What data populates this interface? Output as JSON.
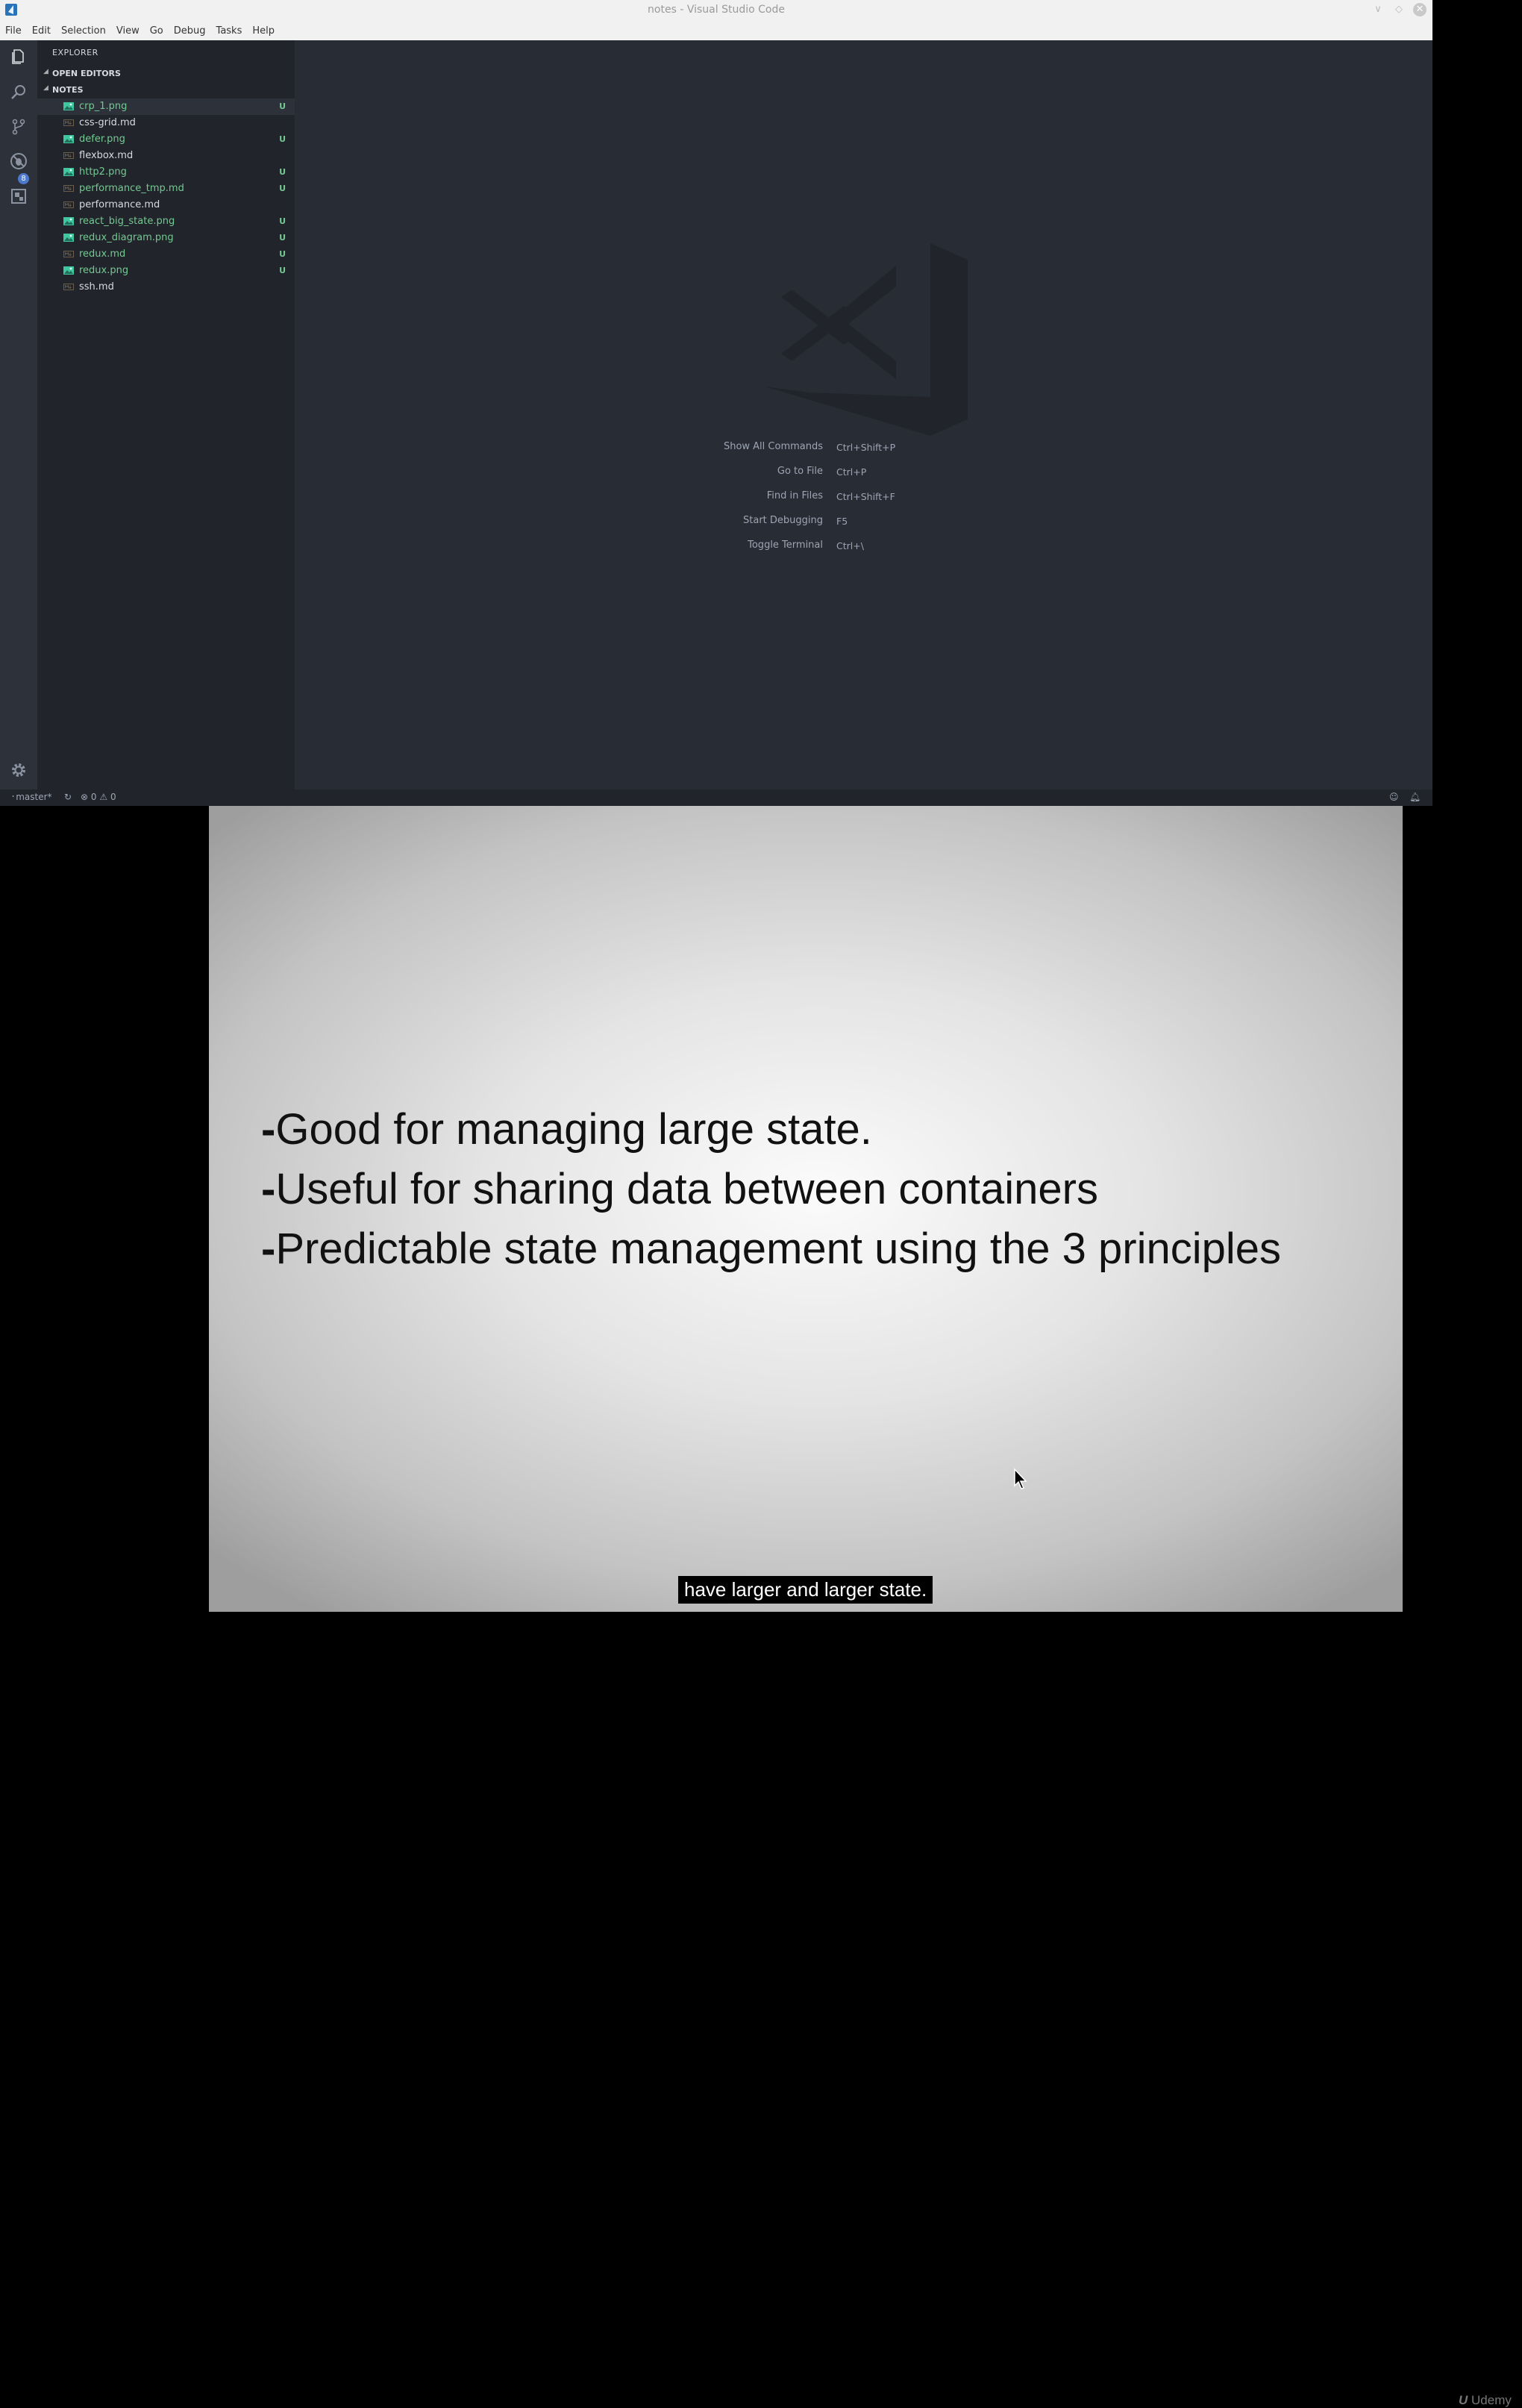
{
  "window": {
    "title": "notes - Visual Studio Code",
    "controls": [
      "minimize",
      "maximize",
      "close"
    ]
  },
  "menu": [
    "File",
    "Edit",
    "Selection",
    "View",
    "Go",
    "Debug",
    "Tasks",
    "Help"
  ],
  "activity_bar": {
    "icons": [
      "files-icon",
      "search-icon",
      "source-control-icon",
      "debug-icon",
      "extensions-icon",
      "gear-icon"
    ],
    "scm_badge": "8"
  },
  "explorer": {
    "title": "EXPLORER",
    "open_editors": "OPEN EDITORS",
    "folder": "NOTES",
    "files": [
      {
        "name": "crp_1.png",
        "type": "image",
        "status": "U",
        "color": "#73c991"
      },
      {
        "name": "css-grid.md",
        "type": "markdown",
        "status": "",
        "color": "#d7dae0"
      },
      {
        "name": "defer.png",
        "type": "image",
        "status": "U",
        "color": "#73c991"
      },
      {
        "name": "flexbox.md",
        "type": "markdown",
        "status": "",
        "color": "#d7dae0"
      },
      {
        "name": "http2.png",
        "type": "image",
        "status": "U",
        "color": "#73c991"
      },
      {
        "name": "performance_tmp.md",
        "type": "markdown",
        "status": "U",
        "color": "#73c991"
      },
      {
        "name": "performance.md",
        "type": "markdown",
        "status": "",
        "color": "#d7dae0"
      },
      {
        "name": "react_big_state.png",
        "type": "image",
        "status": "U",
        "color": "#73c991"
      },
      {
        "name": "redux_diagram.png",
        "type": "image",
        "status": "U",
        "color": "#73c991"
      },
      {
        "name": "redux.md",
        "type": "markdown",
        "status": "U",
        "color": "#73c991"
      },
      {
        "name": "redux.png",
        "type": "image",
        "status": "U",
        "color": "#73c991"
      },
      {
        "name": "ssh.md",
        "type": "markdown",
        "status": "",
        "color": "#d7dae0"
      }
    ]
  },
  "welcome": {
    "commands": [
      {
        "label": "Show All Commands",
        "key": "Ctrl+Shift+P"
      },
      {
        "label": "Go to File",
        "key": "Ctrl+P"
      },
      {
        "label": "Find in Files",
        "key": "Ctrl+Shift+F"
      },
      {
        "label": "Start Debugging",
        "key": "F5"
      },
      {
        "label": "Toggle Terminal",
        "key": "Ctrl+\\"
      }
    ]
  },
  "status_bar": {
    "branch": "master*",
    "errors": "0",
    "warnings": "0"
  },
  "slide": {
    "bullets": [
      "Good for managing large state.",
      "Useful for sharing data between containers",
      "Predictable state management using the 3 principles"
    ],
    "dash": "-",
    "caption": "have larger and larger state.",
    "watermark": "Udemy"
  }
}
